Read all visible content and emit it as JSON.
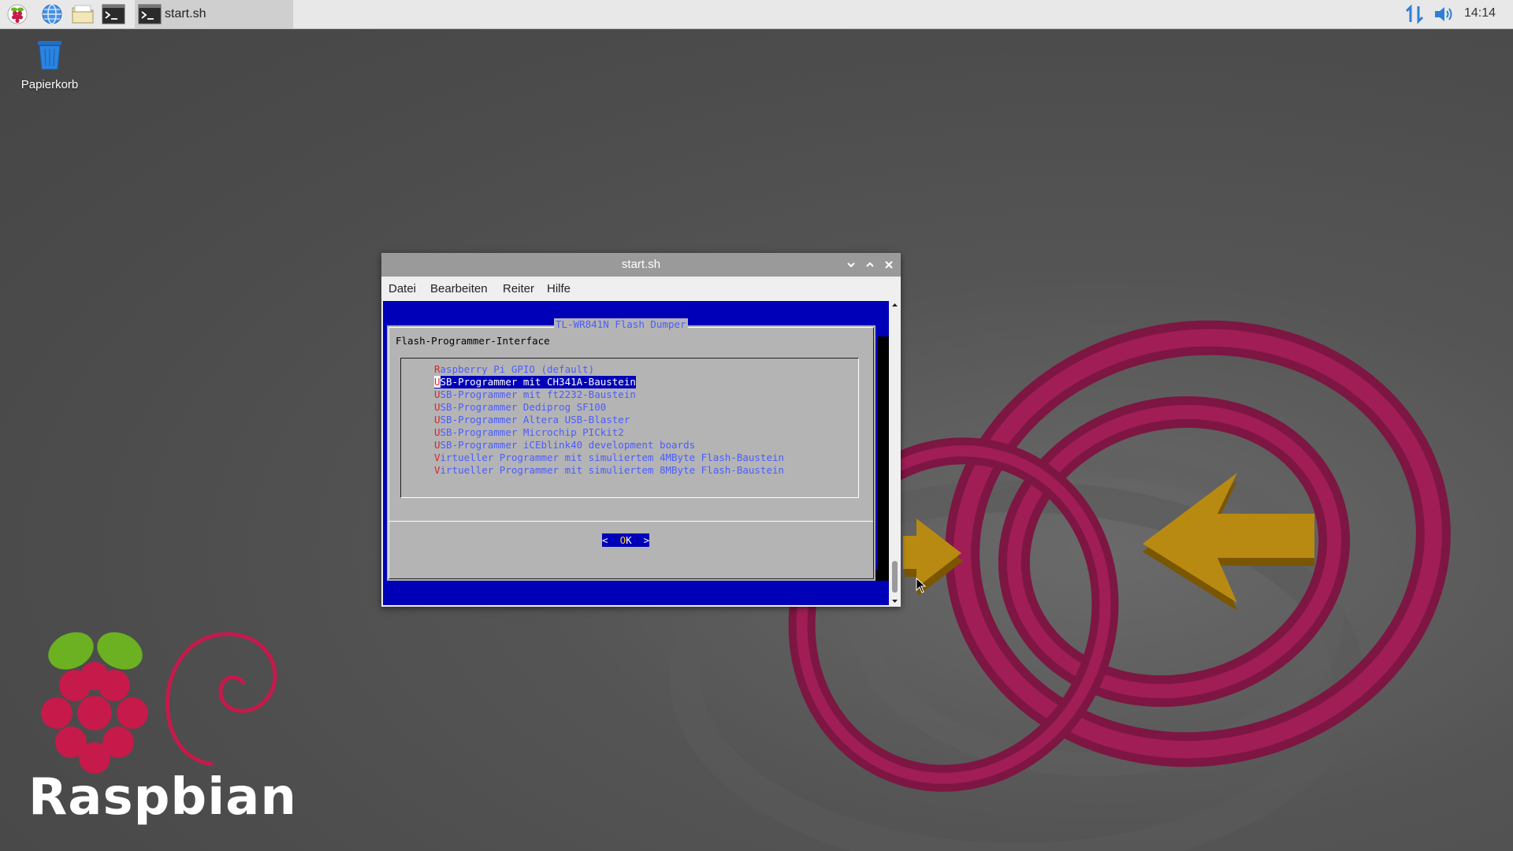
{
  "taskbar": {
    "launchers": [
      "raspberry-menu-icon",
      "web-browser-icon",
      "file-manager-icon",
      "terminal-icon"
    ],
    "task_label": "start.sh",
    "clock": "14:14"
  },
  "desktop": {
    "trash_label": "Papierkorb",
    "brand_text": "Raspbian"
  },
  "window": {
    "title": "start.sh",
    "menu": [
      "Datei",
      "Bearbeiten",
      "Reiter",
      "Hilfe"
    ]
  },
  "dialog": {
    "title": "TL-WR841N Flash Dumper",
    "subtitle": "Flash-Programmer-Interface",
    "items": [
      {
        "hot": "R",
        "rest": "aspberry Pi GPIO (default)"
      },
      {
        "hot": "U",
        "rest": "SB-Programmer mit CH341A-Baustein"
      },
      {
        "hot": "U",
        "rest": "SB-Programmer mit ft2232-Baustein"
      },
      {
        "hot": "U",
        "rest": "SB-Programmer Dediprog SF100"
      },
      {
        "hot": "U",
        "rest": "SB-Programmer Altera USB-Blaster"
      },
      {
        "hot": "U",
        "rest": "SB-Programmer Microchip PICkit2"
      },
      {
        "hot": "U",
        "rest": "SB-Programmer iCEblink40 development boards"
      },
      {
        "hot": "V",
        "rest": "irtueller Programmer mit simuliertem 4MByte Flash-Baustein"
      },
      {
        "hot": "V",
        "rest": "irtueller Programmer mit simuliertem 8MByte Flash-Baustein"
      }
    ],
    "selected_index": 1,
    "ok_left": "<  ",
    "ok_hot": "O",
    "ok_rest": "K  >"
  },
  "colors": {
    "terminal_bg": "#0000b8",
    "dialog_bg": "#b4b4b4",
    "item_text": "#4b5dff",
    "hotkey": "#d8242c",
    "raspberry": "#9b1a4b",
    "arrow": "#b8860b"
  }
}
